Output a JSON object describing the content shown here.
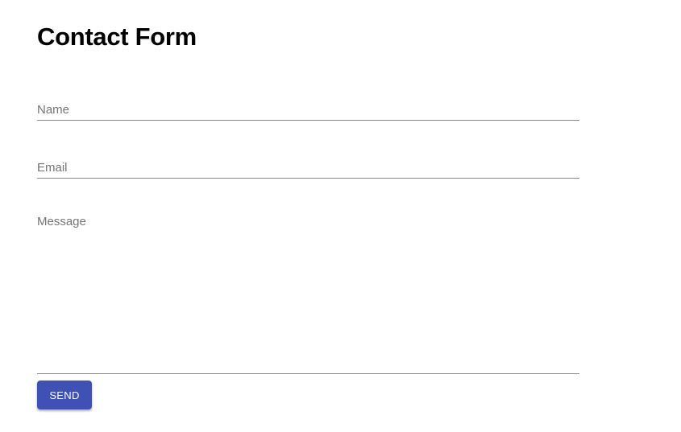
{
  "page": {
    "title": "Contact Form"
  },
  "form": {
    "name": {
      "value": "",
      "placeholder": "Name"
    },
    "email": {
      "value": "",
      "placeholder": "Email"
    },
    "message": {
      "value": "",
      "placeholder": "Message"
    },
    "send_label": "SEND"
  },
  "colors": {
    "accent": "#3f51b5",
    "underline": "#8a8a8a",
    "placeholder": "#757575"
  }
}
